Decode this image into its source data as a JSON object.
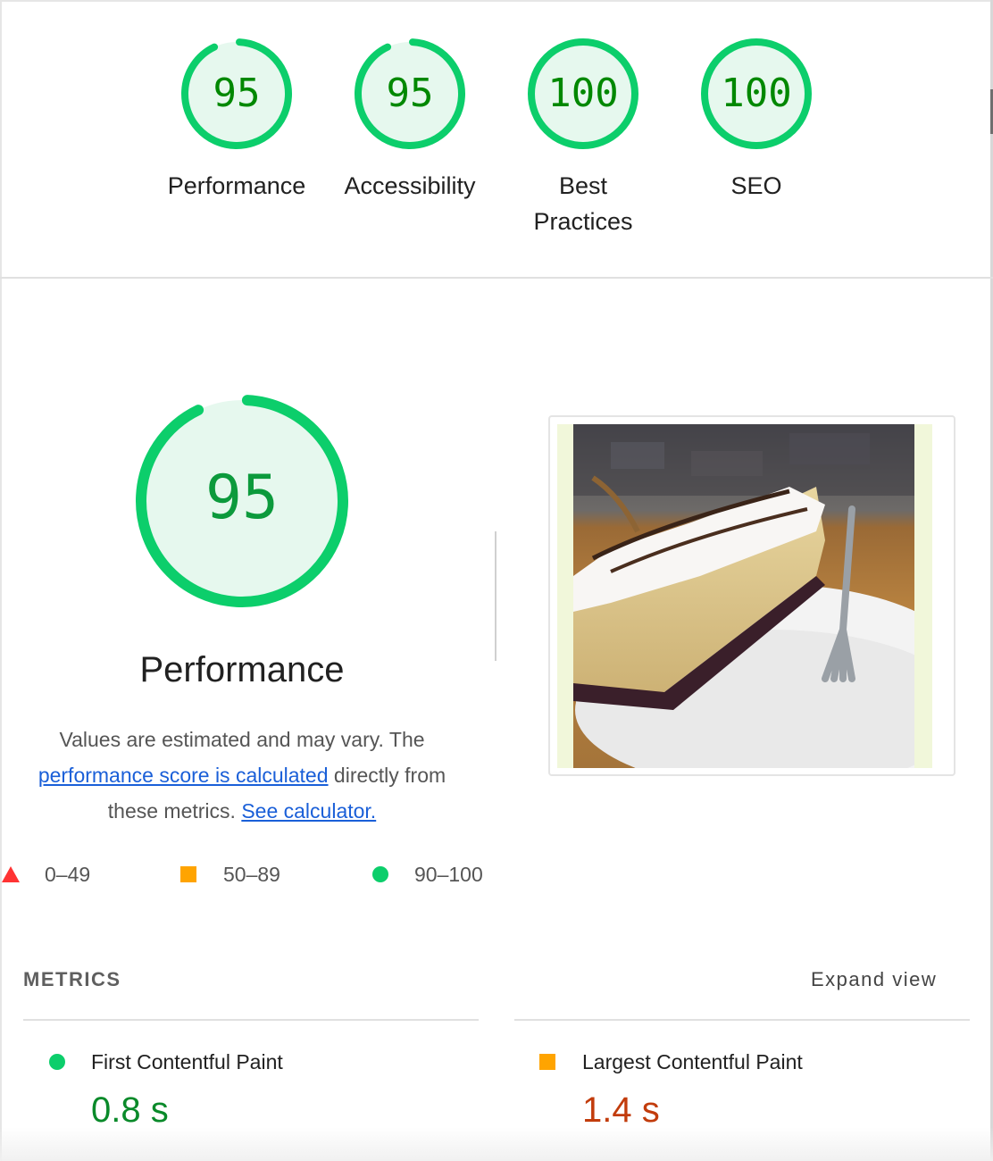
{
  "summary": {
    "gauges": [
      {
        "score": "95",
        "label": "Performance",
        "fraction": 0.95
      },
      {
        "score": "95",
        "label": "Accessibility",
        "fraction": 0.95
      },
      {
        "score": "100",
        "label": "Best Practices",
        "fraction": 1.0
      },
      {
        "score": "100",
        "label": "SEO",
        "fraction": 1.0
      }
    ]
  },
  "performance": {
    "score": "95",
    "fraction": 0.95,
    "title": "Performance",
    "desc_1": "Values are estimated and may vary. The",
    "link_score": "performance score is calculated",
    "desc_2": "directly from these metrics.",
    "link_calculator": "See calculator."
  },
  "legend": {
    "fail": "0–49",
    "average": "50–89",
    "pass": "90–100"
  },
  "metrics": {
    "header": "METRICS",
    "expand": "Expand view",
    "items": [
      {
        "name": "First Contentful Paint",
        "value": "0.8 s",
        "status": "pass"
      },
      {
        "name": "Largest Contentful Paint",
        "value": "1.4 s",
        "status": "average"
      }
    ]
  },
  "colors": {
    "pass": "#0cce6b",
    "pass_bg": "#e6f8ee",
    "pass_text": "#008800",
    "average": "#ffa400",
    "fail": "#ff3333",
    "link": "#1a5fd8"
  }
}
